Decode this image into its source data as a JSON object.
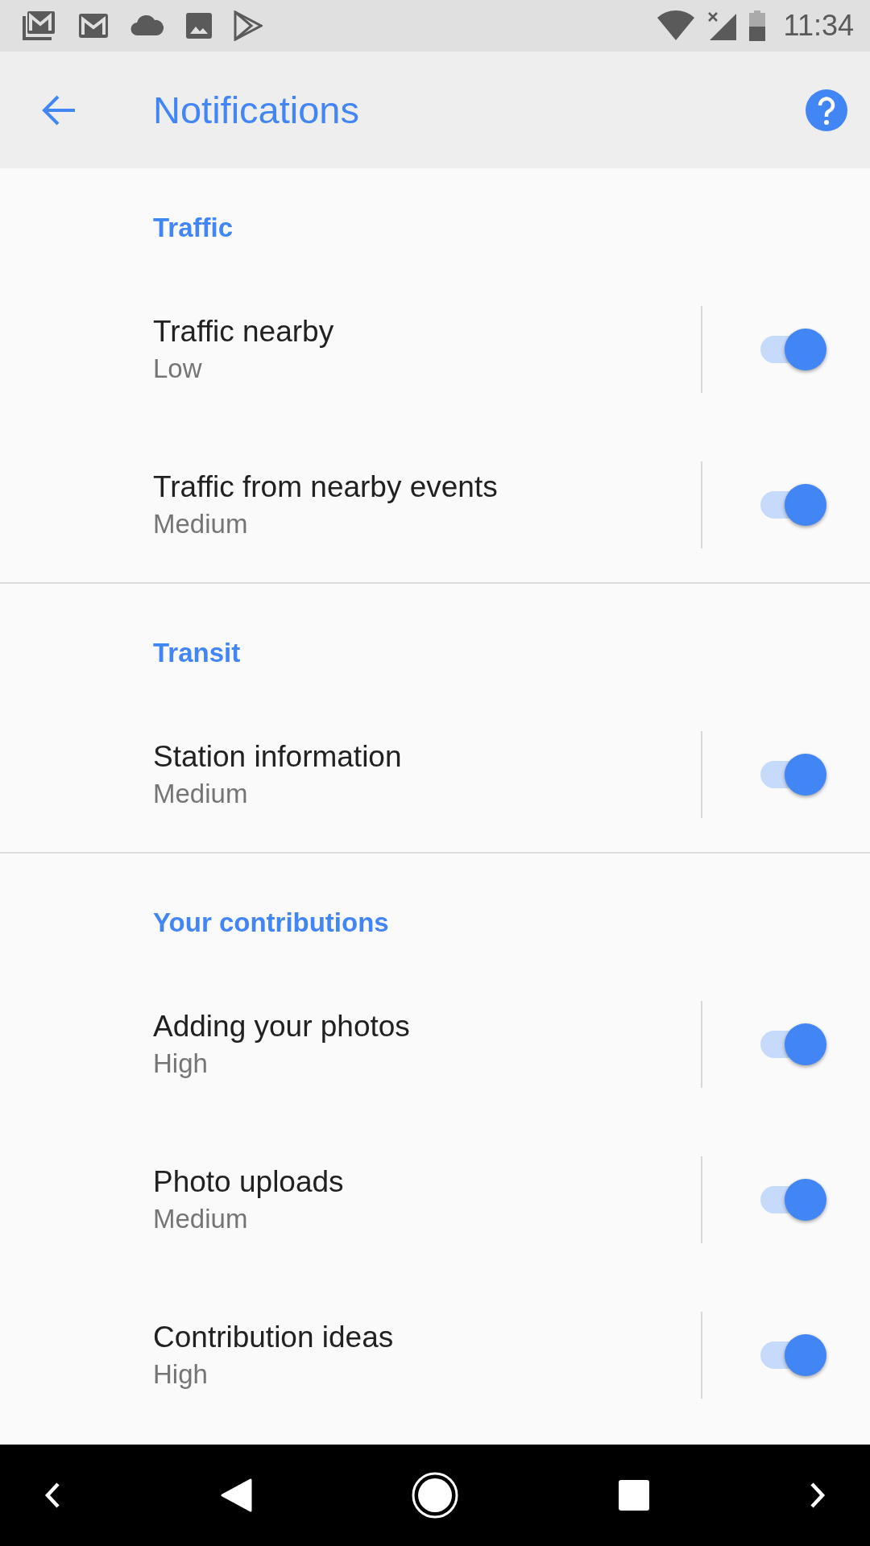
{
  "status_bar": {
    "time": "11:34"
  },
  "app_bar": {
    "title": "Notifications"
  },
  "sections": [
    {
      "header": "Traffic",
      "items": [
        {
          "title": "Traffic nearby",
          "subtitle": "Low",
          "on": true
        },
        {
          "title": "Traffic from nearby events",
          "subtitle": "Medium",
          "on": true
        }
      ]
    },
    {
      "header": "Transit",
      "items": [
        {
          "title": "Station information",
          "subtitle": "Medium",
          "on": true
        }
      ]
    },
    {
      "header": "Your contributions",
      "items": [
        {
          "title": "Adding your photos",
          "subtitle": "High",
          "on": true
        },
        {
          "title": "Photo uploads",
          "subtitle": "Medium",
          "on": true
        },
        {
          "title": "Contribution ideas",
          "subtitle": "High",
          "on": true
        }
      ]
    }
  ]
}
